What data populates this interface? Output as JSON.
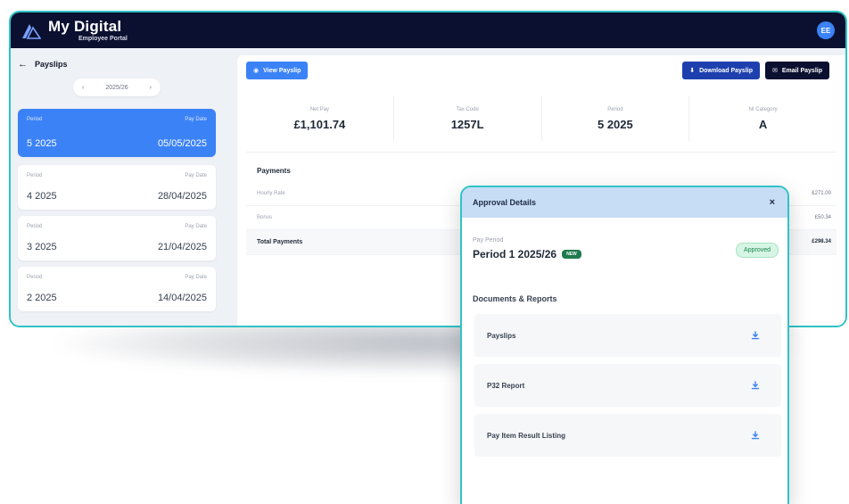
{
  "app": {
    "title": "My Digital",
    "subtitle": "Employee Portal",
    "avatar_initials": "EE"
  },
  "sidebar": {
    "heading": "Payslips",
    "year": "2025/26",
    "prev_symbol": "‹",
    "next_symbol": "›",
    "period_label": "Period",
    "paydate_label": "Pay Date",
    "periods": [
      {
        "period": "5 2025",
        "pay_date": "05/05/2025",
        "active": true
      },
      {
        "period": "4 2025",
        "pay_date": "28/04/2025",
        "active": false
      },
      {
        "period": "3 2025",
        "pay_date": "21/04/2025",
        "active": false
      },
      {
        "period": "2 2025",
        "pay_date": "14/04/2025",
        "active": false
      }
    ]
  },
  "toolbar": {
    "view_label": "View Payslip",
    "download_label": "Download Payslip",
    "email_label": "Email Payslip"
  },
  "summary": [
    {
      "label": "Net Pay",
      "value": "£1,101.74"
    },
    {
      "label": "Tax Code",
      "value": "1257L"
    },
    {
      "label": "Period",
      "value": "5 2025"
    },
    {
      "label": "NI Category",
      "value": "A"
    }
  ],
  "payments": {
    "heading": "Payments",
    "rows": [
      {
        "label": "Hourly Rate",
        "amount": "£271.00"
      },
      {
        "label": "Bonus",
        "amount": "£50.34"
      }
    ],
    "total": {
      "label": "Total Payments",
      "amount": "£298.34"
    }
  },
  "modal": {
    "title": "Approval Details",
    "close_symbol": "×",
    "pay_period_label": "Pay Period",
    "pay_period_value": "Period 1 2025/26",
    "tag": "NEW",
    "status": "Approved",
    "docs_heading": "Documents & Reports",
    "docs": [
      {
        "label": "Payslips"
      },
      {
        "label": "P32 Report"
      },
      {
        "label": "Pay Item Result Listing"
      }
    ]
  },
  "colors": {
    "topbar": "#0b1030",
    "accent": "#3b82f6",
    "frame": "#2ec4c6",
    "approved": "#18874b"
  }
}
